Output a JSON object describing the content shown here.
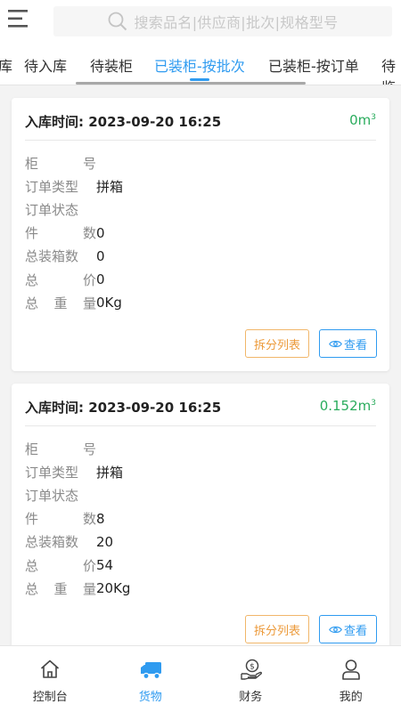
{
  "header": {
    "search_placeholder": "搜索品名|供应商|批次|规格型号"
  },
  "tabs": [
    {
      "label": "入库"
    },
    {
      "label": "待入库"
    },
    {
      "label": "待装柜"
    },
    {
      "label": "已装柜-按批次",
      "active": true
    },
    {
      "label": "已装柜-按订单"
    },
    {
      "label": "待鉴"
    }
  ],
  "cards": [
    {
      "time_label": "入库时间:",
      "time_value": "2023-09-20 16:25",
      "volume": "0m",
      "volume_sup": "3",
      "rows": [
        {
          "key": [
            "柜",
            "号"
          ],
          "value": ""
        },
        {
          "key": [
            "订单类型"
          ],
          "value": "拼箱"
        },
        {
          "key": [
            "订单状态"
          ],
          "value": ""
        },
        {
          "key": [
            "件",
            "数"
          ],
          "value": "0"
        },
        {
          "key": [
            "总装箱数"
          ],
          "value": "0"
        },
        {
          "key": [
            "总",
            "价"
          ],
          "value": "0"
        },
        {
          "key": [
            "总",
            "重",
            "量"
          ],
          "value": "0Kg"
        }
      ],
      "split_label": "拆分列表",
      "view_label": "查看"
    },
    {
      "time_label": "入库时间:",
      "time_value": "2023-09-20 16:25",
      "volume": "0.152m",
      "volume_sup": "3",
      "rows": [
        {
          "key": [
            "柜",
            "号"
          ],
          "value": ""
        },
        {
          "key": [
            "订单类型"
          ],
          "value": "拼箱"
        },
        {
          "key": [
            "订单状态"
          ],
          "value": ""
        },
        {
          "key": [
            "件",
            "数"
          ],
          "value": "8"
        },
        {
          "key": [
            "总装箱数"
          ],
          "value": "20"
        },
        {
          "key": [
            "总",
            "价"
          ],
          "value": "54"
        },
        {
          "key": [
            "总",
            "重",
            "量"
          ],
          "value": "20Kg"
        }
      ],
      "split_label": "拆分列表",
      "view_label": "查看"
    }
  ],
  "bottom_nav": [
    {
      "label": "控制台",
      "icon": "home-icon"
    },
    {
      "label": "货物",
      "icon": "truck-icon",
      "active": true
    },
    {
      "label": "财务",
      "icon": "money-hand-icon"
    },
    {
      "label": "我的",
      "icon": "user-icon"
    }
  ],
  "colors": {
    "accent": "#2f9bf0",
    "volume_green": "#2aac5d",
    "split_orange": "#ec9a3a"
  }
}
